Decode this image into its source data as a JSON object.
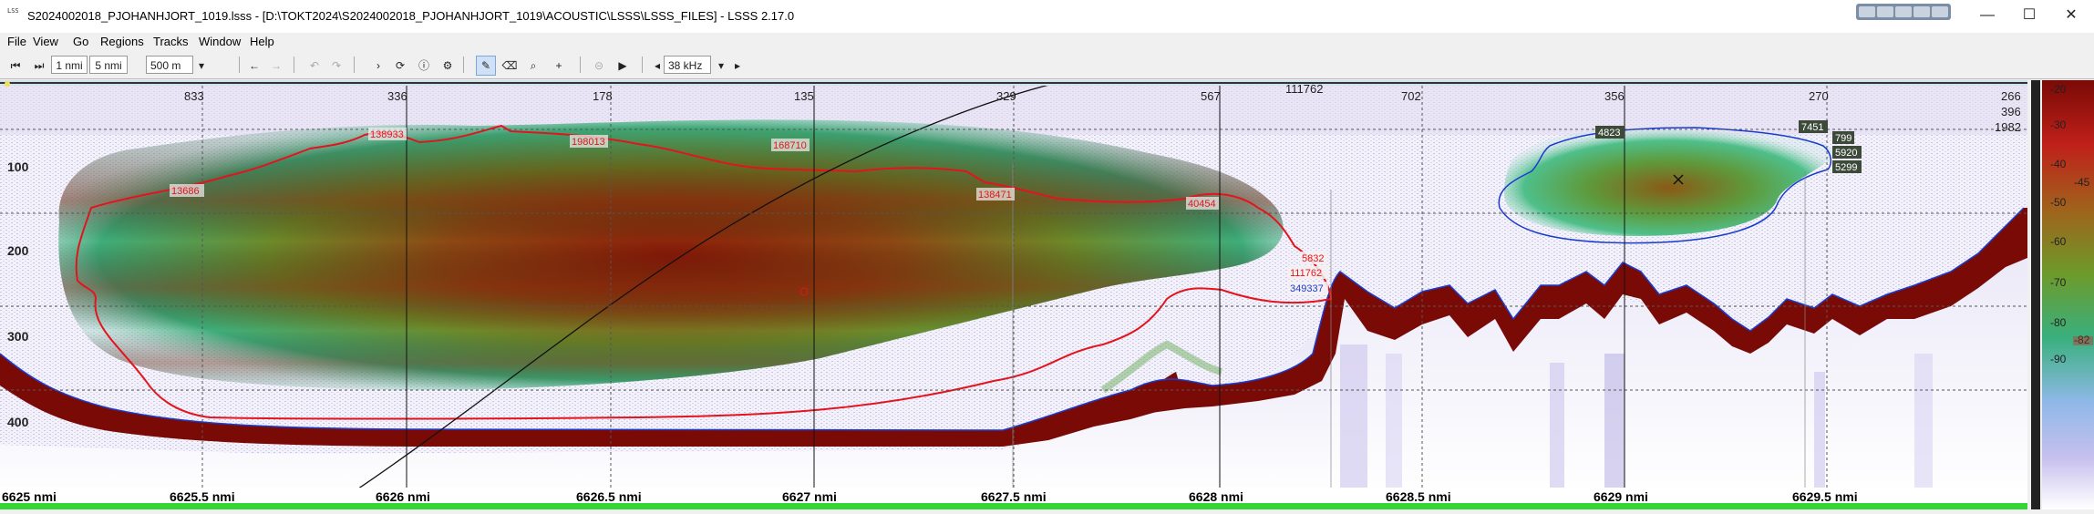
{
  "window": {
    "title": "S2024002018_PJOHANHJORT_1019.lsss - [D:\\TOKT2024\\S2024002018_PJOHANHJORT_1019\\ACOUSTIC\\LSSS\\LSSS_FILES] - LSSS 2.17.0",
    "icon_text": "LSS",
    "minimize": "—",
    "maximize": "☐",
    "close": "✕"
  },
  "menu": [
    "File",
    "View",
    "Go",
    "Regions",
    "Tracks",
    "Window",
    "Help"
  ],
  "toolbar": {
    "step_small": "1 nmi",
    "step_large": "5 nmi",
    "range": "500 m",
    "frequency": "38 kHz"
  },
  "echogram": {
    "top_axis_labels": [
      "833",
      "336",
      "178",
      "135",
      "329",
      "567",
      "111762",
      "702",
      "356",
      "270",
      "266"
    ],
    "top_right_values": [
      "396",
      "1982"
    ],
    "depth_labels": [
      "100",
      "200",
      "300",
      "400"
    ],
    "distance_labels": [
      "6625 nmi",
      "6625.5 nmi",
      "6626 nmi",
      "6626.5 nmi",
      "6627 nmi",
      "6627.5 nmi",
      "6628 nmi",
      "6628.5 nmi",
      "6629 nmi",
      "6629.5 nmi"
    ],
    "color_scale_labels": [
      "-20",
      "-30",
      "-40",
      "-45",
      "-50",
      "-60",
      "-70",
      "-80",
      "-82",
      "-90"
    ],
    "red_region_labels": [
      "138933",
      "198013",
      "168710",
      "13686",
      "138471",
      "40454",
      "5832",
      "111762"
    ],
    "blue_region_labels": [
      "349337"
    ],
    "school_labels": [
      "4823",
      "7451",
      "799",
      "5920",
      "5299"
    ]
  },
  "colors": {
    "region_red": "#e3141e",
    "region_blue": "#1a3ccf",
    "seabed": "#7a0a06",
    "scale_marker": "#e3141e"
  }
}
